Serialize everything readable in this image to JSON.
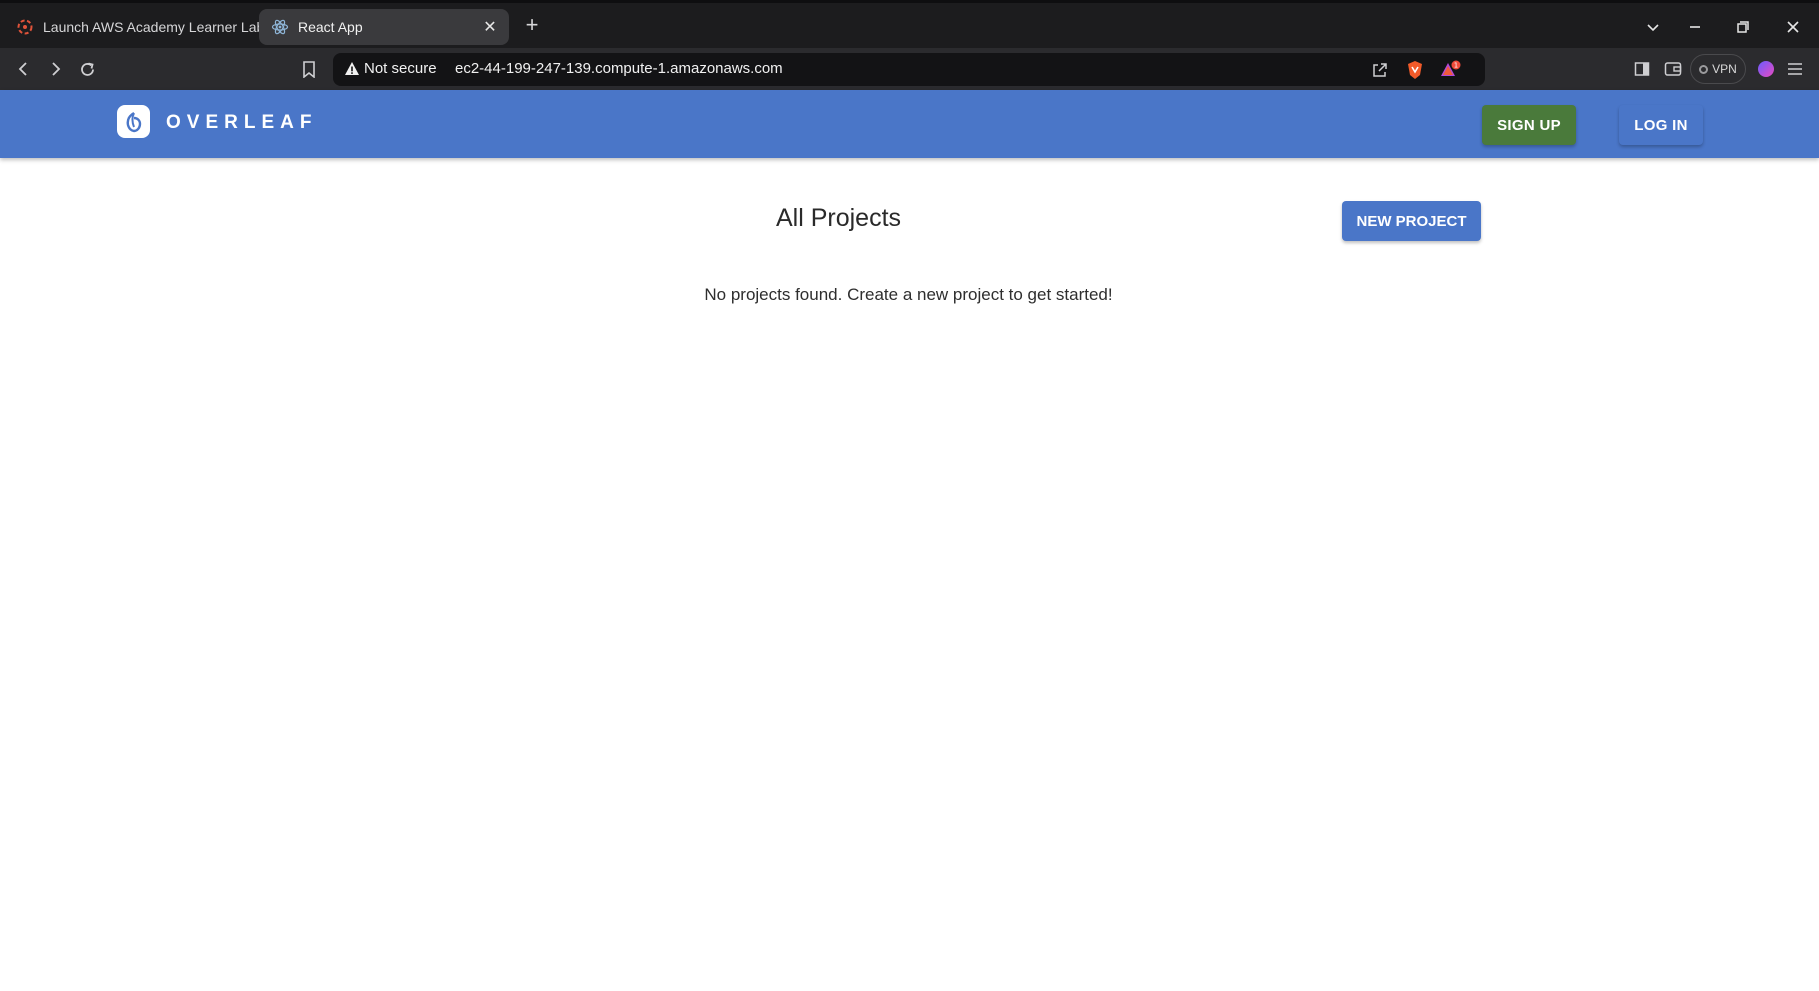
{
  "browser": {
    "tabs": [
      {
        "title": "Launch AWS Academy Learner Lab",
        "favicon": "aws-academy-icon",
        "active": false
      },
      {
        "title": "React App",
        "favicon": "react-icon",
        "active": true
      }
    ],
    "new_tab_icon": "plus-icon",
    "window_controls": [
      "chevron-down-icon",
      "minimize-icon",
      "restore-icon",
      "close-icon"
    ],
    "address": {
      "security_label": "Not secure",
      "url": "ec2-44-199-247-139.compute-1.amazonaws.com"
    },
    "brave_notification_count": "1",
    "vpn_label": "VPN"
  },
  "app": {
    "brand": "OVERLEAF",
    "nav": {
      "signup_label": "SIGN UP",
      "login_label": "LOG IN"
    },
    "main": {
      "title": "All Projects",
      "new_project_label": "NEW PROJECT",
      "empty_message": "No projects found. Create a new project to get started!"
    },
    "colors": {
      "header": "#4a76c8",
      "signup": "#4a7a3b",
      "primary": "#4a76c8"
    }
  }
}
